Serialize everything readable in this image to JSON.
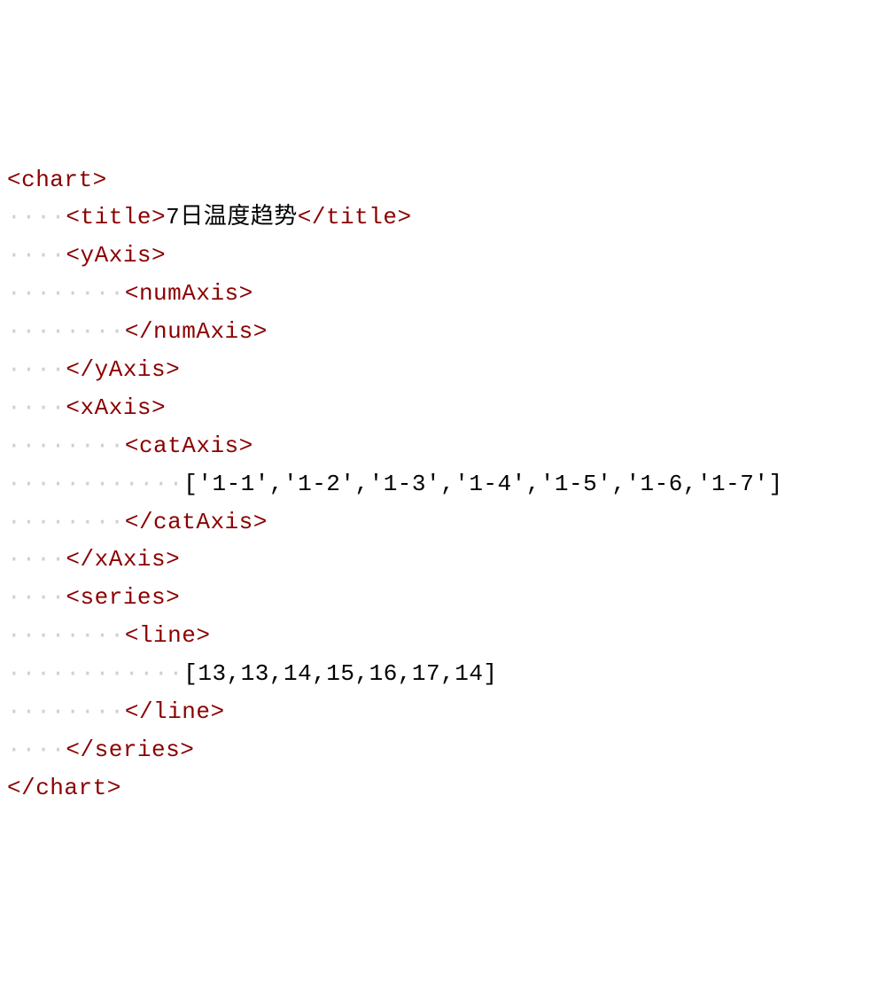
{
  "code": {
    "lines": [
      {
        "indent": 0,
        "tag_open": "<chart>",
        "content": "",
        "tag_close": ""
      },
      {
        "indent": 1,
        "tag_open": "<title>",
        "content": "7日温度趋势",
        "tag_close": "</title>"
      },
      {
        "indent": 1,
        "tag_open": "<yAxis>",
        "content": "",
        "tag_close": ""
      },
      {
        "indent": 2,
        "tag_open": "<numAxis>",
        "content": "",
        "tag_close": ""
      },
      {
        "indent": 2,
        "tag_open": "</numAxis>",
        "content": "",
        "tag_close": ""
      },
      {
        "indent": 1,
        "tag_open": "</yAxis>",
        "content": "",
        "tag_close": ""
      },
      {
        "indent": 1,
        "tag_open": "<xAxis>",
        "content": "",
        "tag_close": ""
      },
      {
        "indent": 2,
        "tag_open": "<catAxis>",
        "content": "",
        "tag_close": ""
      },
      {
        "indent": 3,
        "tag_open": "",
        "content": "['1-1','1-2','1-3','1-4','1-5','1-6,'1-7']",
        "tag_close": ""
      },
      {
        "indent": 2,
        "tag_open": "</catAxis>",
        "content": "",
        "tag_close": ""
      },
      {
        "indent": 1,
        "tag_open": "</xAxis>",
        "content": "",
        "tag_close": ""
      },
      {
        "indent": 1,
        "tag_open": "<series>",
        "content": "",
        "tag_close": ""
      },
      {
        "indent": 2,
        "tag_open": "<line>",
        "content": "",
        "tag_close": ""
      },
      {
        "indent": 3,
        "tag_open": "",
        "content": "[13,13,14,15,16,17,14]",
        "tag_close": ""
      },
      {
        "indent": 2,
        "tag_open": "</line>",
        "content": "",
        "tag_close": ""
      },
      {
        "indent": 1,
        "tag_open": "</series>",
        "content": "",
        "tag_close": ""
      },
      {
        "indent": 0,
        "tag_open": "</chart>",
        "content": "",
        "tag_close": ""
      }
    ],
    "ws_unit": "····"
  },
  "chart_data": {
    "type": "line",
    "title": "7日温度趋势",
    "categories": [
      "1-1",
      "1-2",
      "1-3",
      "1-4",
      "1-5",
      "1-6",
      "1-7"
    ],
    "values": [
      13,
      13,
      14,
      15,
      16,
      17,
      14
    ],
    "xlabel": "",
    "ylabel": ""
  }
}
